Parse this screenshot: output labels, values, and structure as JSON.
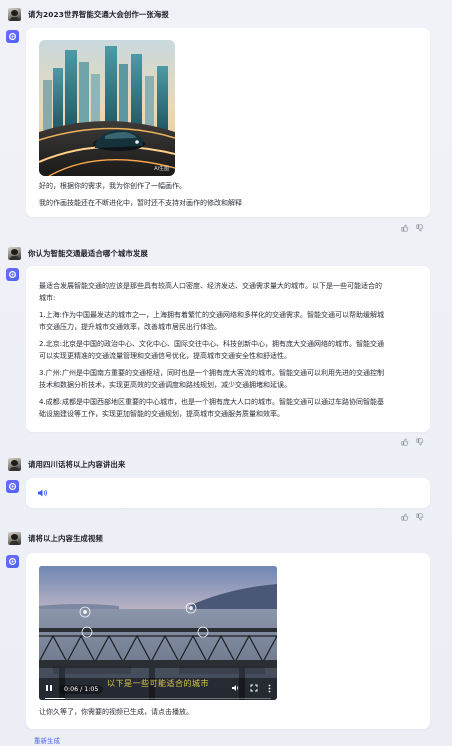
{
  "conversation": [
    {
      "user_prompt": "请为2023世界智能交通大会创作一张海报",
      "poster_watermark": "AI生图",
      "reply_lines": [
        "好的，根据你的需求，我为你创作了一幅画作。",
        "我的作画技能还在不断进化中，暂时还不支持对画作的修改和解释"
      ]
    },
    {
      "user_prompt": "你认为智能交通最适合哪个城市发展",
      "reply_lines": [
        "最适合发展智能交通的应该是那些具有较高人口密度、经济发达、交通需求量大的城市。以下是一些可能适合的",
        "城市:",
        "1.上海:作为中国最发达的城市之一，上海拥有着繁忙的交通网络和多样化的交通需求。智能交通可以帮助缓解城",
        "市交通压力，提升城市交通效率，改善城市居民出行体验。",
        "2.北京:北京是中国的政治中心、文化中心、国际交往中心、科技创新中心，拥有庞大交通网络的城市。智能交通",
        "可以实现更精准的交通流量管理和交通信号优化，提高城市交通安全性和舒适性。",
        "3.广州:广州是中国南方重要的交通枢纽，同时也是一个拥有庞大客流的城市。智能交通可以利用先进的交通控制",
        "技术和数据分析技术，实现更高效的交通调度和路线规划，减少交通拥堵和延误。",
        "4.成都:成都是中国西部地区重要的中心城市，也是一个拥有庞大人口的城市。智能交通可以通过车路协同智能基",
        "础设施建设等工作，实现更加智能的交通规划，提高城市交通服务质量和效率。"
      ]
    },
    {
      "user_prompt": "请用四川话将以上内容讲出来"
    },
    {
      "user_prompt": "请将以上内容生成视频",
      "video": {
        "time": "0:06 / 1:05",
        "subtitle": "以下是一些可能适合的城市",
        "progress": 0.09
      },
      "reply": "让你久等了，你需要的视频已生成，请点击播放。"
    }
  ],
  "footer": {
    "regenerate_label": "重新生成"
  },
  "colors": {
    "accent": "#4a63f0",
    "background": "#eef0f7",
    "card": "#ffffff",
    "subtitle": "#d8c94a"
  },
  "icons": [
    "avatar",
    "bot-icon",
    "thumb-up-icon",
    "thumb-down-icon",
    "speaker-icon",
    "play-pause-icon",
    "volume-icon",
    "fullscreen-icon",
    "more-icon"
  ]
}
